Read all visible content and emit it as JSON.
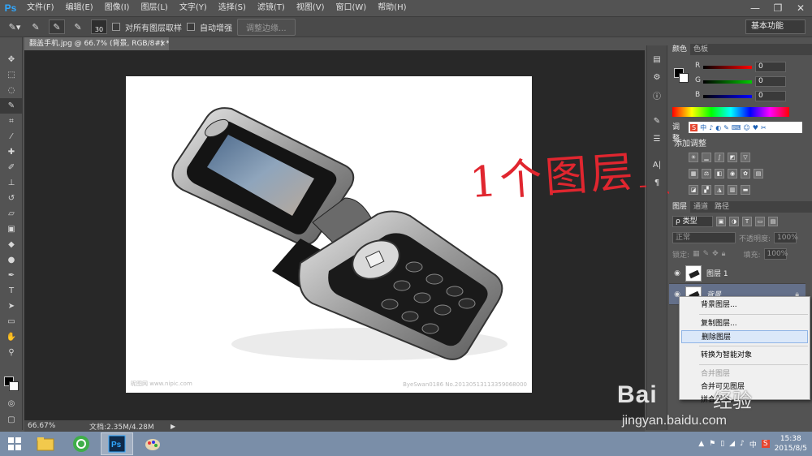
{
  "app": {
    "logo": "Ps"
  },
  "menu": [
    "文件(F)",
    "编辑(E)",
    "图像(I)",
    "图层(L)",
    "文字(Y)",
    "选择(S)",
    "滤镜(T)",
    "视图(V)",
    "窗口(W)",
    "帮助(H)"
  ],
  "window_controls": {
    "minimize": "—",
    "restore": "❐",
    "close": "✕"
  },
  "options": {
    "brush_size": "30",
    "sample_all_layers": "对所有图层取样",
    "auto_enhance": "自动增强",
    "refine_edge": "调整边缘...",
    "workspace": "基本功能"
  },
  "document": {
    "tab_title": "翻盖手机.jpg @ 66.7% (背景, RGB/8#) *",
    "tab_close": "×",
    "watermark_left": "昵图网 www.nipic.com",
    "watermark_right": "ByeSwan0186  No.20130513113359068000",
    "zoom": "66.67%",
    "doc_info": "文档:2.35M/4.28M",
    "status_arrow": "▶"
  },
  "annotation": {
    "text": "1个图层"
  },
  "color_panel": {
    "tabs": [
      "颜色",
      "色板"
    ],
    "r_label": "R",
    "r_value": "0",
    "g_label": "G",
    "g_value": "0",
    "b_label": "B",
    "b_value": "0"
  },
  "adjust_panel": {
    "tab": "调整",
    "title": "添加调整",
    "sogou": [
      "S",
      "中",
      "♪",
      "◐",
      "✎",
      "⌨",
      "☺",
      "♥",
      "✂"
    ]
  },
  "layers_panel": {
    "tabs": [
      "图层",
      "通道",
      "路径"
    ],
    "filter": "ρ 类型",
    "blend_mode": "正常",
    "opacity_label": "不透明度:",
    "opacity_value": "100%",
    "lock_label": "锁定:",
    "fill_label": "填充:",
    "fill_value": "100%",
    "layers": [
      {
        "name": "图层 1"
      },
      {
        "name": "背景"
      }
    ]
  },
  "context_menu": {
    "items": [
      "背景图层...",
      "复制图层...",
      "删除图层",
      "转换为智能对象",
      "合并图层",
      "合并可见图层",
      "拼合图像"
    ]
  },
  "taskbar": {
    "tray": [
      "▲",
      "⚑",
      "▯",
      "◢",
      "♪",
      "中",
      "S"
    ],
    "time": "15:38",
    "date": "2015/8/5"
  },
  "baidu_watermark": {
    "logo": "Bai",
    "logo2": "经验",
    "url": "jingyan.baidu.com"
  }
}
